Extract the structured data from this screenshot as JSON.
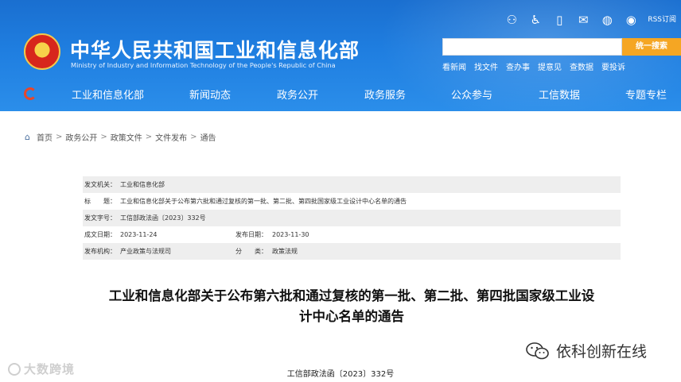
{
  "header": {
    "title_cn": "中华人民共和国工业和信息化部",
    "title_en": "Ministry of Industry and Information Technology of the People's Republic of China",
    "rss_label": "RSS订阅",
    "search": {
      "placeholder": "",
      "button_label": "统一搜索"
    },
    "quick_links": [
      "看新闻",
      "找文件",
      "查办事",
      "提意见",
      "查数据",
      "要投诉"
    ],
    "icons": [
      "accessibility-icon",
      "wheelchair-icon",
      "mobile-icon",
      "mail-icon",
      "wechat-icon",
      "weibo-icon"
    ]
  },
  "nav": {
    "items": [
      "工业和信息化部",
      "新闻动态",
      "政务公开",
      "政务服务",
      "公众参与",
      "工信数据",
      "专题专栏"
    ]
  },
  "breadcrumb": [
    "首页",
    "政务公开",
    "政策文件",
    "文件发布",
    "通告"
  ],
  "meta": {
    "issuer_label": "发文机关：",
    "issuer": "工业和信息化部",
    "title_label": "标　　题：",
    "title": "工业和信息化部关于公布第六批和通过复核的第一批、第二批、第四批国家级工业设计中心名单的通告",
    "doc_no_label": "发文字号：",
    "doc_no": "工信部政法函〔2023〕332号",
    "written_label": "成文日期：",
    "written_date": "2023-11-24",
    "published_label": "发布日期：",
    "published_date": "2023-11-30",
    "agency_label": "发布机构：",
    "agency": "产业政策与法规司",
    "category_label": "分　　类：",
    "category": "政策法规"
  },
  "article": {
    "title_line1": "工业和信息化部关于公布第六批和通过复核的第一批、第二批、第四批国家级工业设",
    "title_line2": "计中心名单的通告",
    "doc_number": "工信部政法函〔2023〕332号"
  },
  "watermarks": {
    "left": "大数跨境",
    "right": "依科创新在线"
  },
  "colors": {
    "header_blue": "#1f7ee0",
    "search_button": "#f5a623",
    "meta_shade": "#eeeeee"
  }
}
